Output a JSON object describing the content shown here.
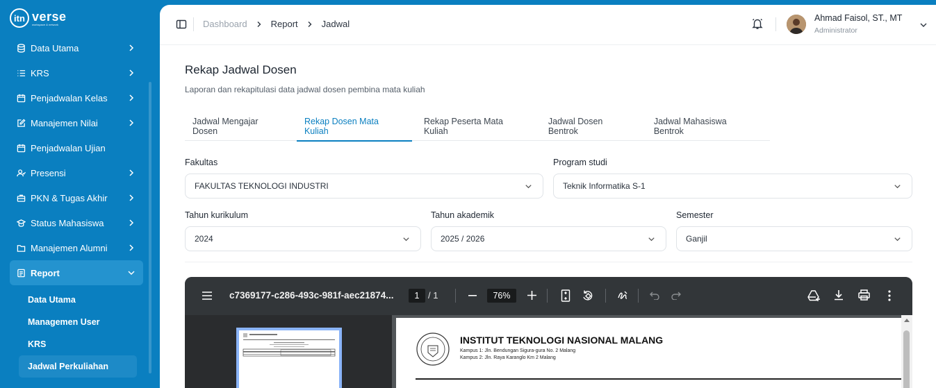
{
  "brand": {
    "mark": "itn",
    "name": "verse",
    "tagline": "workspace & network"
  },
  "sidebar": {
    "items": [
      {
        "label": "Data Utama",
        "icon": "database-icon",
        "has_chevron": true
      },
      {
        "label": "KRS",
        "icon": "list-icon",
        "has_chevron": true
      },
      {
        "label": "Penjadwalan Kelas",
        "icon": "calendar-icon",
        "has_chevron": true
      },
      {
        "label": "Manajemen Nilai",
        "icon": "edit-icon",
        "has_chevron": true
      },
      {
        "label": "Penjadwalan Ujian",
        "icon": "calendar-icon",
        "has_chevron": false
      },
      {
        "label": "Presensi",
        "icon": "user-check-icon",
        "has_chevron": true
      },
      {
        "label": "PKN & Tugas Akhir",
        "icon": "briefcase-icon",
        "has_chevron": true
      },
      {
        "label": "Status Mahasiswa",
        "icon": "graduation-icon",
        "has_chevron": true
      },
      {
        "label": "Manajemen Alumni",
        "icon": "folder-icon",
        "has_chevron": true
      },
      {
        "label": "Report",
        "icon": "report-icon",
        "has_chevron": true,
        "expanded": true
      }
    ],
    "report_subitems": [
      {
        "label": "Data Utama"
      },
      {
        "label": "Managemen User"
      },
      {
        "label": "KRS"
      },
      {
        "label": "Jadwal Perkuliahan",
        "active": true
      }
    ]
  },
  "topbar": {
    "breadcrumb": [
      "Dashboard",
      "Report",
      "Jadwal"
    ],
    "user": {
      "name": "Ahmad Faisol, ST., MT",
      "role": "Administrator"
    }
  },
  "page": {
    "title": "Rekap Jadwal Dosen",
    "description": "Laporan dan rekapitulasi data jadwal dosen pembina mata kuliah"
  },
  "tabs": [
    {
      "label": "Jadwal Mengajar Dosen"
    },
    {
      "label": "Rekap Dosen Mata Kuliah",
      "active": true
    },
    {
      "label": "Rekap Peserta Mata Kuliah"
    },
    {
      "label": "Jadwal Dosen Bentrok"
    },
    {
      "label": "Jadwal Mahasiswa Bentrok"
    }
  ],
  "filters": {
    "fakultas": {
      "label": "Fakultas",
      "value": "FAKULTAS TEKNOLOGI INDUSTRI"
    },
    "prodi": {
      "label": "Program studi",
      "value": "Teknik Informatika S-1"
    },
    "kurikulum": {
      "label": "Tahun kurikulum",
      "value": "2024"
    },
    "akademik": {
      "label": "Tahun akademik",
      "value": "2025 / 2026"
    },
    "semester": {
      "label": "Semester",
      "value": "Ganjil"
    }
  },
  "pdf": {
    "filename": "c7369177-c286-493c-981f-aec21874...",
    "page": "1",
    "total": "/ 1",
    "zoom": "76%",
    "doc": {
      "institution": "INSTITUT TEKNOLOGI NASIONAL MALANG",
      "address1": "Kampus 1: Jln. Bendungan Sigura-gura No. 2 Malang",
      "address2": "Kampus 2: Jln. Raya Karanglo Km 2 Malang"
    }
  },
  "colors": {
    "primary": "#0a7fc0",
    "pdf_toolbar": "#323639"
  }
}
